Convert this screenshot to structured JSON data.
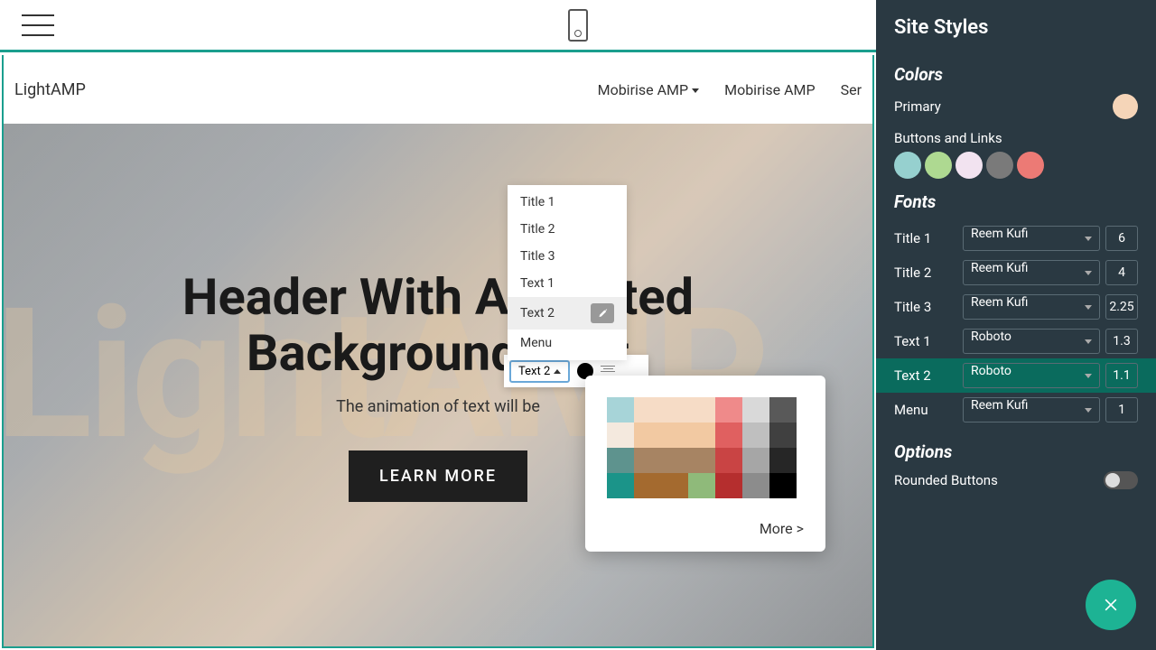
{
  "brand": "LightAMP",
  "watermark": "LightAMP",
  "nav": {
    "item1": "Mobirise AMP",
    "item2": "Mobirise AMP",
    "item3": "Ser"
  },
  "hero": {
    "title_line1": "Header With Animated",
    "title_line2": "Background Text",
    "subtitle": "The animation of text will be",
    "cta": "LEARN MORE"
  },
  "style_menu": {
    "items": [
      "Title 1",
      "Title 2",
      "Title 3",
      "Text 1",
      "Text 2",
      "Menu"
    ],
    "selected": "Text 2"
  },
  "toolbar": {
    "current": "Text 2"
  },
  "picker": {
    "more": "More >",
    "colors": [
      "#a7d4d8",
      "#f6dcc6",
      "#f6dcc6",
      "#f6dcc6",
      "#ef8a8a",
      "#d9d9d9",
      "#595959",
      "#f4e9de",
      "#f2c9a2",
      "#f2c9a2",
      "#f2c9a2",
      "#e06060",
      "#bfbfbf",
      "#404040",
      "#5e938e",
      "#a78463",
      "#a78463",
      "#a78463",
      "#c94444",
      "#a6a6a6",
      "#262626",
      "#1b9489",
      "#a46a2f",
      "#a46a2f",
      "#8fba7a",
      "#b52e2e",
      "#8c8c8c",
      "#000000"
    ]
  },
  "panel": {
    "title": "Site Styles",
    "sections": {
      "colors": "Colors",
      "fonts": "Fonts",
      "options": "Options"
    },
    "primary_label": "Primary",
    "primary_color": "#f5d5b8",
    "buttons_label": "Buttons and Links",
    "button_colors": [
      "#96d0cf",
      "#aed991",
      "#f2e3f0",
      "#7a7a7a",
      "#ec7a75"
    ],
    "fonts": [
      {
        "label": "Title 1",
        "family": "Reem Kufi",
        "size": "6"
      },
      {
        "label": "Title 2",
        "family": "Reem Kufi",
        "size": "4"
      },
      {
        "label": "Title 3",
        "family": "Reem Kufi",
        "size": "2.25"
      },
      {
        "label": "Text 1",
        "family": "Roboto",
        "size": "1.3"
      },
      {
        "label": "Text 2",
        "family": "Roboto",
        "size": "1.1"
      },
      {
        "label": "Menu",
        "family": "Reem Kufi",
        "size": "1"
      }
    ],
    "active_font_index": 4,
    "rounded_label": "Rounded Buttons"
  }
}
